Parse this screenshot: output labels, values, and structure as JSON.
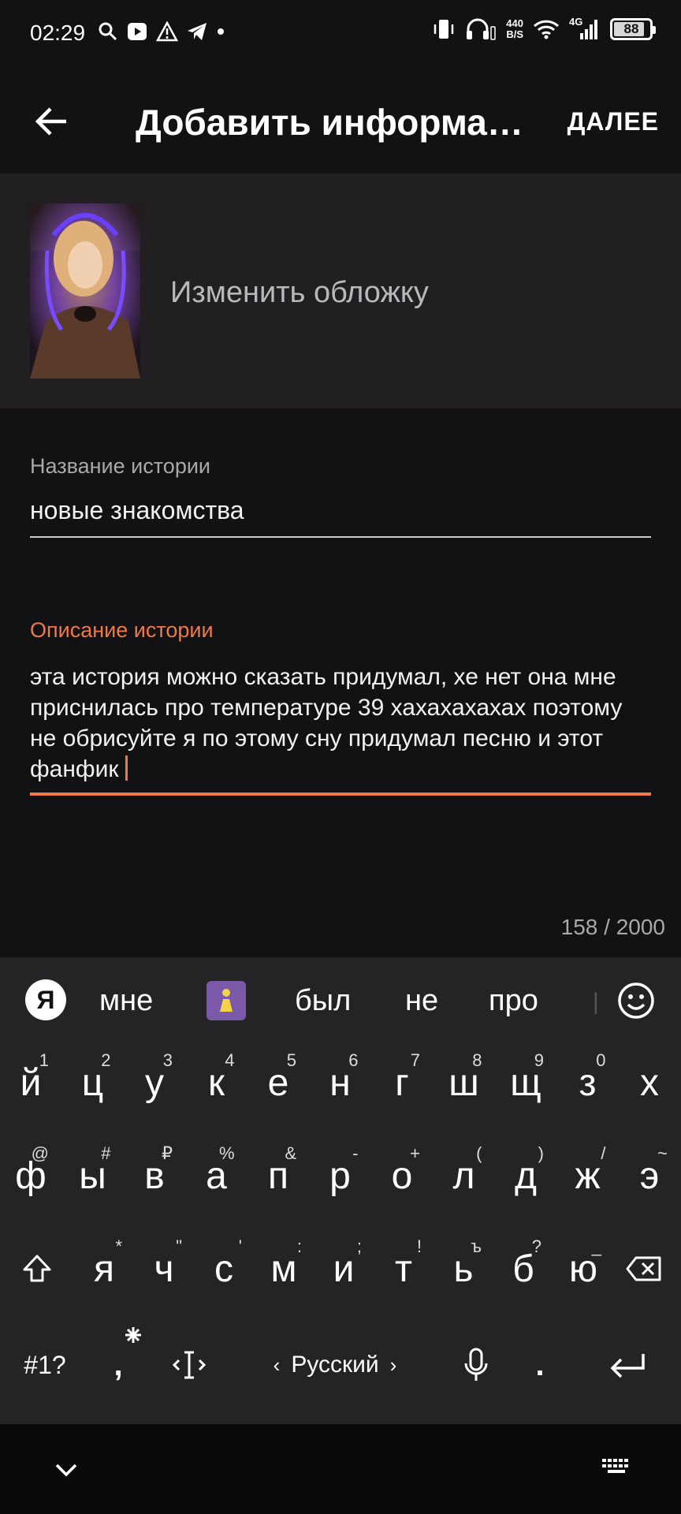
{
  "status_bar": {
    "time": "02:29",
    "speed_top": "440",
    "speed_bottom": "B/S",
    "network": "4G",
    "battery": "88",
    "battery_level": 0.88
  },
  "app_bar": {
    "title": "Добавить информац...",
    "next_label": "ДАЛЕЕ"
  },
  "cover": {
    "change_label": "Изменить обложку"
  },
  "form": {
    "title_label": "Название истории",
    "title_value": "новые знакомства",
    "description_label": "Описание истории",
    "description_value": "эта история можно сказать придумал, хе нет она мне приснилась про температуре 39 хахахахахах поэтому не обрисуйте я по этому сну придумал песню и этот фанфик",
    "counter": "158 / 2000"
  },
  "keyboard": {
    "logo": "Я",
    "suggestions": [
      "мне",
      "был",
      "не",
      "про"
    ],
    "row1": [
      {
        "k": "й",
        "s": "1"
      },
      {
        "k": "ц",
        "s": "2"
      },
      {
        "k": "у",
        "s": "3"
      },
      {
        "k": "к",
        "s": "4"
      },
      {
        "k": "е",
        "s": "5"
      },
      {
        "k": "н",
        "s": "6"
      },
      {
        "k": "г",
        "s": "7"
      },
      {
        "k": "ш",
        "s": "8"
      },
      {
        "k": "щ",
        "s": "9"
      },
      {
        "k": "з",
        "s": "0"
      },
      {
        "k": "х",
        "s": ""
      }
    ],
    "row2": [
      {
        "k": "ф",
        "s": "@"
      },
      {
        "k": "ы",
        "s": "#"
      },
      {
        "k": "в",
        "s": "₽"
      },
      {
        "k": "а",
        "s": "%"
      },
      {
        "k": "п",
        "s": "&"
      },
      {
        "k": "р",
        "s": "-"
      },
      {
        "k": "о",
        "s": "+"
      },
      {
        "k": "л",
        "s": "("
      },
      {
        "k": "д",
        "s": ")"
      },
      {
        "k": "ж",
        "s": "/"
      },
      {
        "k": "э",
        "s": "~"
      }
    ],
    "row3": [
      {
        "k": "я",
        "s": "*"
      },
      {
        "k": "ч",
        "s": "\""
      },
      {
        "k": "с",
        "s": "'"
      },
      {
        "k": "м",
        "s": ":"
      },
      {
        "k": "и",
        "s": ";"
      },
      {
        "k": "т",
        "s": "!"
      },
      {
        "k": "ь",
        "s": "ъ"
      },
      {
        "k": "б",
        "s": "?"
      },
      {
        "k": "ю",
        "s": "_"
      }
    ],
    "symbols_label": "#1?",
    "comma": ",",
    "language": "Русский",
    "period": "."
  }
}
